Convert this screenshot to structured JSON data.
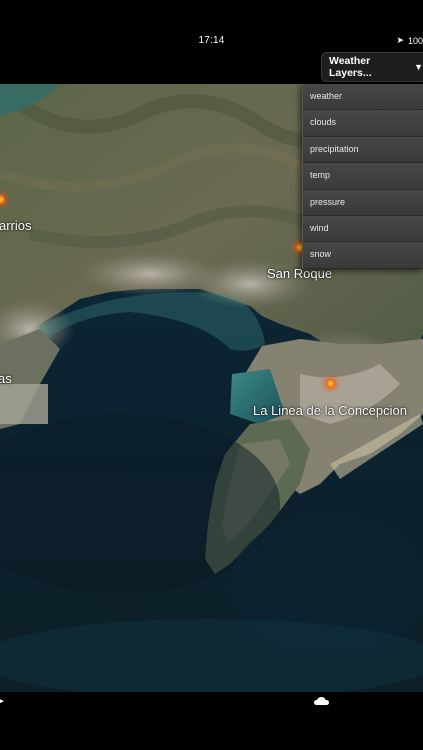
{
  "status_bar": {
    "time": "17:14",
    "battery": "100",
    "location_icon": "location-arrow-icon"
  },
  "weather_layers": {
    "button_label": "Weather Layers...",
    "caret_icon": "caret-down-icon",
    "options": [
      "weather",
      "clouds",
      "precipitation",
      "temp",
      "pressure",
      "wind",
      "snow"
    ]
  },
  "map": {
    "labels": {
      "barrios": "arrios",
      "san_roque": "San Roque",
      "algeciras": "as",
      "la_linea": "La Linea de la Concepcion"
    },
    "marker_icon": "weather-marker-icon"
  },
  "bottom_bar": {
    "left_icon": "arrow-icon",
    "cloud_icon": "cloud-icon"
  }
}
